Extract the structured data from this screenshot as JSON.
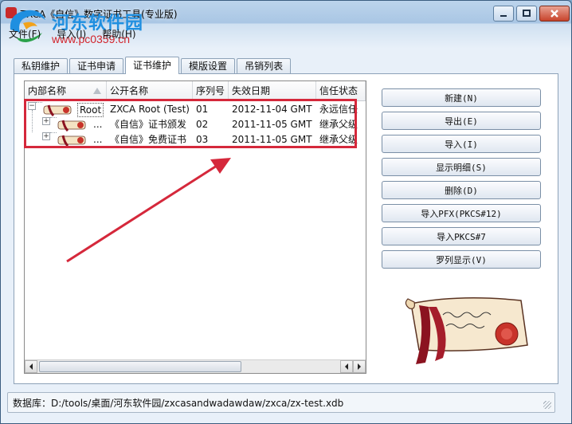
{
  "window": {
    "title": "ZXCA《自信》数字证书工具(专业版)",
    "watermark_name": "河东软件园",
    "watermark_url": "www.pc0359.cn"
  },
  "menu": [
    "文件(F)",
    "导入(I)",
    "帮助(H)"
  ],
  "tabs": [
    {
      "label": "私钥维护",
      "active": false
    },
    {
      "label": "证书申请",
      "active": false
    },
    {
      "label": "证书维护",
      "active": true
    },
    {
      "label": "模版设置",
      "active": false
    },
    {
      "label": "吊销列表",
      "active": false
    }
  ],
  "table": {
    "columns": [
      "内部名称",
      "公开名称",
      "序列号",
      "失效日期",
      "信任状态"
    ],
    "rows": [
      {
        "internal": "Root",
        "public": "ZXCA Root (Test)",
        "serial": "01",
        "expiry": "2012-11-04 GMT",
        "trust": "永远信任"
      },
      {
        "internal": "...",
        "public": "《自信》证书颁发",
        "serial": "02",
        "expiry": "2011-11-05 GMT",
        "trust": "继承父级"
      },
      {
        "internal": "...",
        "public": "《自信》免费证书",
        "serial": "03",
        "expiry": "2011-11-05 GMT",
        "trust": "继承父级"
      }
    ]
  },
  "buttons": [
    "新建(N)",
    "导出(E)",
    "导入(I)",
    "显示明细(S)",
    "删除(D)",
    "导入PFX(PKCS#12)",
    "导入PKCS#7",
    "罗列显示(V)"
  ],
  "status": {
    "text": "数据库：D:/tools/桌面/河东软件园/zxcasandwadawdaw/zxca/zx-test.xdb"
  },
  "colors": {
    "highlight": "#d5283b",
    "accent": "#1f8fe0"
  }
}
